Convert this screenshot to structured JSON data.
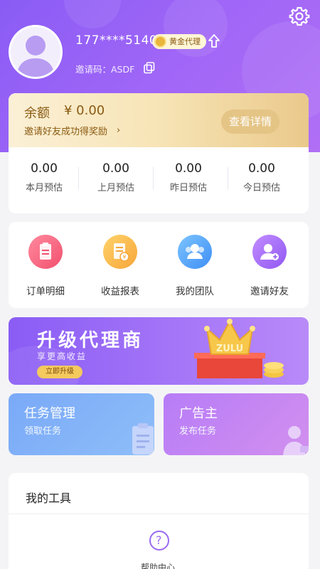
{
  "profile": {
    "phone": "177****5140",
    "level_badge": "黄金代理",
    "invite_code": "邀请码：ASDF"
  },
  "balance": {
    "label": "余额",
    "amount": "¥ 0.00",
    "invite_text": "邀请好友成功得奖励",
    "detail_button": "查看详情"
  },
  "stats": [
    {
      "value": "0.00",
      "label": "本月预估"
    },
    {
      "value": "0.00",
      "label": "上月预估"
    },
    {
      "value": "0.00",
      "label": "昨日预估"
    },
    {
      "value": "0.00",
      "label": "今日预估"
    }
  ],
  "menu": [
    {
      "label": "订单明细",
      "icon": "order-icon"
    },
    {
      "label": "收益报表",
      "icon": "report-icon"
    },
    {
      "label": "我的团队",
      "icon": "team-icon"
    },
    {
      "label": "邀请好友",
      "icon": "invite-friend-icon"
    }
  ],
  "banner": {
    "title": "升级代理商",
    "subtitle": "享更高收益",
    "button": "立即升级",
    "crown_text": "ZULU"
  },
  "tasks": {
    "left": {
      "title": "任务管理",
      "subtitle": "领取任务"
    },
    "right": {
      "title": "广告主",
      "subtitle": "发布任务"
    }
  },
  "tools": {
    "title": "我的工具",
    "items": [
      {
        "label": "帮助中心",
        "icon": "help-icon"
      }
    ]
  },
  "colors": {
    "primary": "#8a5cf5",
    "gold": "#e5c586",
    "task_blue": "#7aa9f8",
    "task_purple": "#b77cf7"
  }
}
